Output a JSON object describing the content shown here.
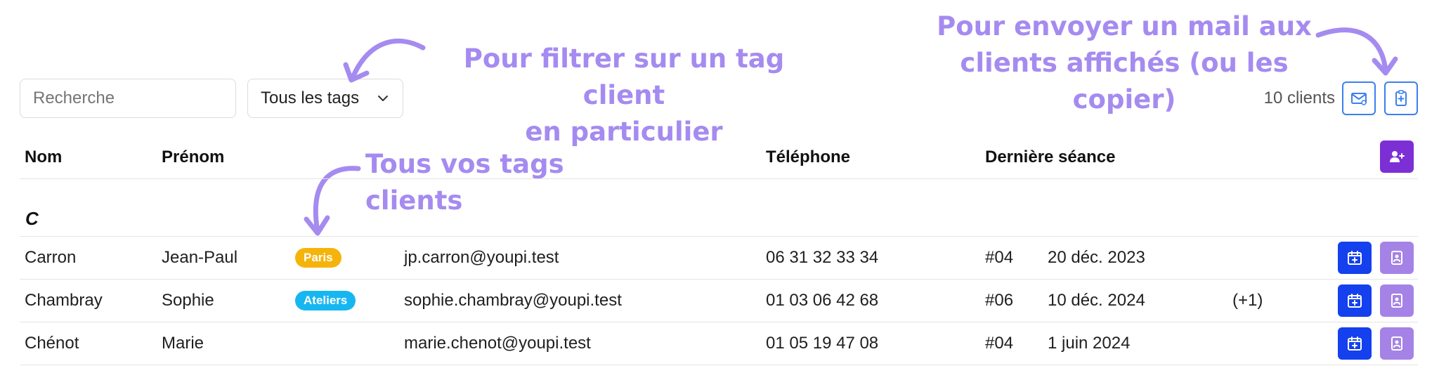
{
  "toolbar": {
    "search_placeholder": "Recherche",
    "tag_filter_label": "Tous les tags",
    "client_count": "10 clients"
  },
  "annotations": {
    "filter_line1": "Pour filtrer sur un tag client",
    "filter_line2": "en particulier",
    "mail_line1": "Pour envoyer un mail aux",
    "mail_line2": "clients affichés (ou les copier)",
    "tags": "Tous vos tags clients"
  },
  "table": {
    "headers": {
      "nom": "Nom",
      "prenom": "Prénom",
      "telephone": "Téléphone",
      "derniere_seance": "Dernière séance"
    },
    "section_letter": "C",
    "rows": [
      {
        "nom": "Carron",
        "prenom": "Jean-Paul",
        "tag": "Paris",
        "tag_color": "#f5b40c",
        "email": "jp.carron@youpi.test",
        "telephone": "06 31 32 33 34",
        "seance_num": "#04",
        "seance_date": "20 déc. 2023",
        "extra": ""
      },
      {
        "nom": "Chambray",
        "prenom": "Sophie",
        "tag": "Ateliers",
        "tag_color": "#16b7f0",
        "email": "sophie.chambray@youpi.test",
        "telephone": "01 03 06 42 68",
        "seance_num": "#06",
        "seance_date": "10 déc. 2024",
        "extra": "(+1)"
      },
      {
        "nom": "Chénot",
        "prenom": "Marie",
        "tag": "",
        "tag_color": "",
        "email": "marie.chenot@youpi.test",
        "telephone": "01 05 19 47 08",
        "seance_num": "#04",
        "seance_date": "1 juin 2024",
        "extra": ""
      }
    ]
  },
  "icons": {
    "tag_dropdown": "chevron-down-icon",
    "mail": "mail-icon",
    "copy": "clipboard-icon",
    "add_client": "user-plus-icon",
    "schedule": "calendar-plus-icon",
    "client_file": "contact-card-icon"
  },
  "colors": {
    "accent_purple": "#7d2fd6",
    "annotation": "#a58bf0",
    "primary_blue": "#1440ee",
    "outline_blue": "#3a7ff0",
    "file_button": "#a582e6"
  }
}
